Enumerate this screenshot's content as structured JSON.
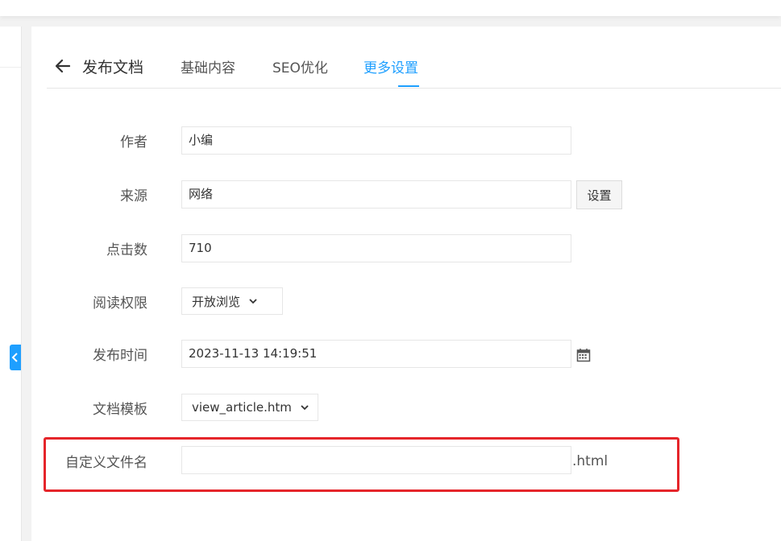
{
  "header": {
    "back_icon": "arrow-left-icon",
    "title": "发布文档"
  },
  "tabs": [
    {
      "label": "基础内容",
      "active": false
    },
    {
      "label": "SEO优化",
      "active": false
    },
    {
      "label": "更多设置",
      "active": true
    }
  ],
  "form": {
    "author": {
      "label": "作者",
      "value": "小编"
    },
    "source": {
      "label": "来源",
      "value": "网络",
      "button": "设置"
    },
    "clicks": {
      "label": "点击数",
      "value": "710"
    },
    "permission": {
      "label": "阅读权限",
      "selected": "开放浏览"
    },
    "publish_time": {
      "label": "发布时间",
      "value": "2023-11-13 14:19:51",
      "icon": "calendar-icon"
    },
    "template": {
      "label": "文档模板",
      "selected": "view_article.htm"
    },
    "custom_filename": {
      "label": "自定义文件名",
      "value": "",
      "suffix": ".html"
    }
  },
  "colors": {
    "accent": "#1e9fff",
    "highlight": "#e5252a"
  }
}
